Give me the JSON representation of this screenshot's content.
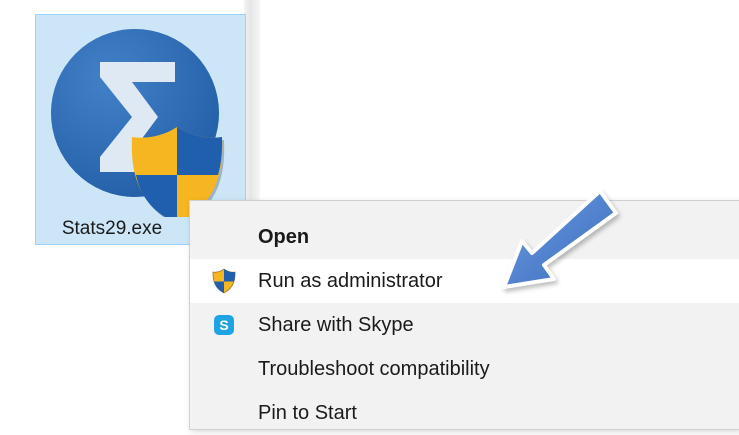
{
  "file": {
    "name": "Stats29.exe",
    "icon": "sigma-app-icon-with-uac-shield"
  },
  "context_menu": {
    "items": [
      {
        "label": "Open",
        "icon": "",
        "bold": true
      },
      {
        "label": "Run as administrator",
        "icon": "uac-shield-icon",
        "highlighted": true
      },
      {
        "label": "Share with Skype",
        "icon": "skype-icon"
      },
      {
        "label": "Troubleshoot compatibility",
        "icon": ""
      },
      {
        "label": "Pin to Start",
        "icon": ""
      }
    ]
  },
  "skype_icon_letter": "S",
  "colors": {
    "selection_tile": "#cde6f7",
    "app_circle": "#2b6cb7",
    "shield_blue": "#1f5fad",
    "shield_yellow": "#f5b622",
    "arrow_blue": "#4a7fcc",
    "menu_bg": "#f2f2f2",
    "menu_hover": "#ffffff"
  }
}
